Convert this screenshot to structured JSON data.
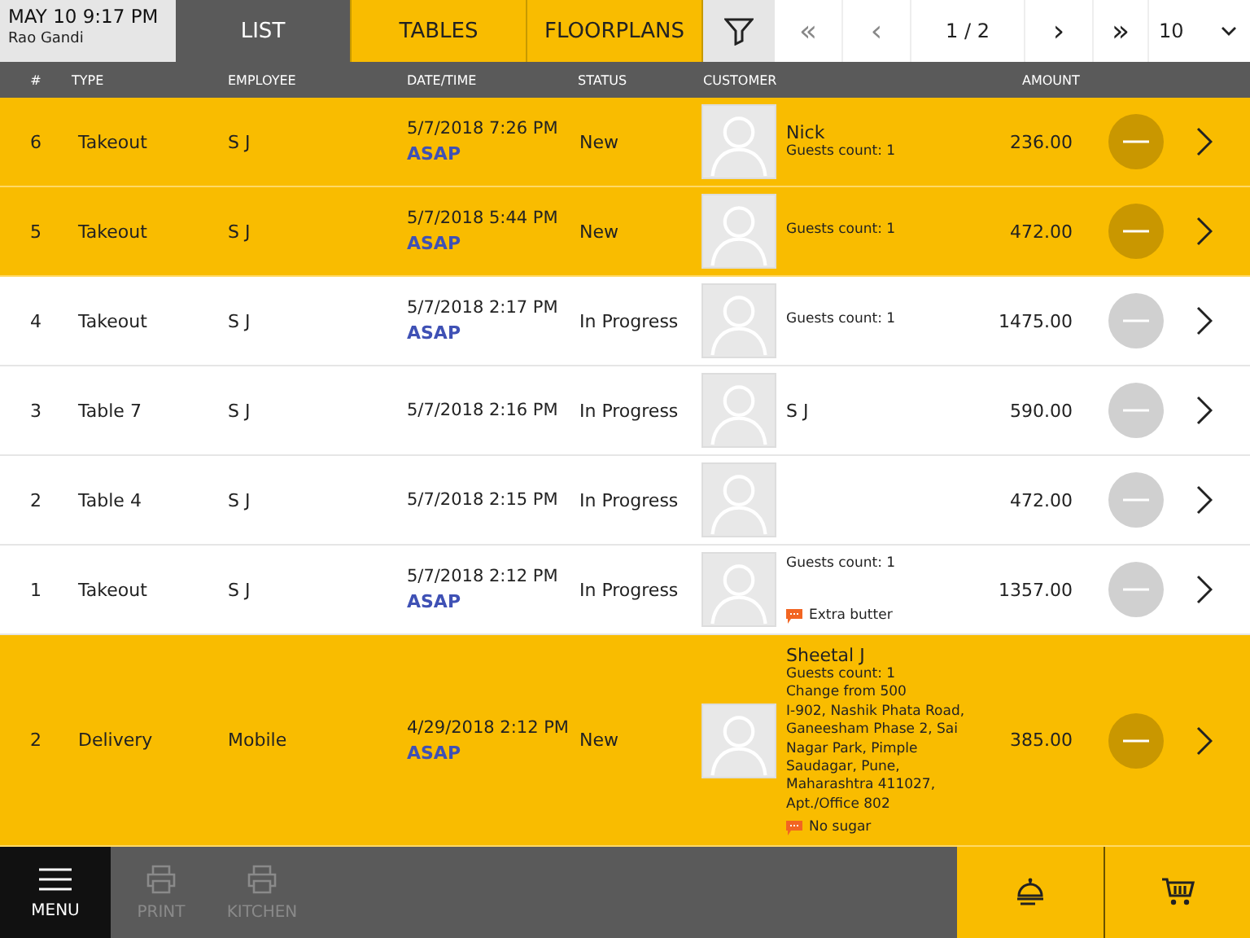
{
  "header": {
    "date": "MAY 10 9:17 PM",
    "user": "Rao Gandi"
  },
  "tabs": [
    {
      "label": "LIST",
      "selected": true
    },
    {
      "label": "TABLES",
      "selected": false
    },
    {
      "label": "FLOORPLANS",
      "selected": false
    }
  ],
  "pager": {
    "first": "«",
    "prev": "‹",
    "page": "1 / 2",
    "next": "›",
    "last": "»",
    "page_size": "10"
  },
  "columns": [
    "#",
    "TYPE",
    "EMPLOYEE",
    "DATE/TIME",
    "STATUS",
    "CUSTOMER",
    "AMOUNT"
  ],
  "rows": [
    {
      "number": "6",
      "type": "Takeout",
      "employee": "S J",
      "datetime": "5/7/2018 7:26 PM",
      "asap": "ASAP",
      "status": "New",
      "highlighted": true,
      "customer": {
        "name": "Nick",
        "details": [
          "Guests count: 1"
        ]
      },
      "amount": "236.00"
    },
    {
      "number": "5",
      "type": "Takeout",
      "employee": "S J",
      "datetime": "5/7/2018 5:44 PM",
      "asap": "ASAP",
      "status": "New",
      "highlighted": true,
      "customer": {
        "details": [
          "Guests count: 1"
        ]
      },
      "amount": "472.00"
    },
    {
      "number": "4",
      "type": "Takeout",
      "employee": "S J",
      "datetime": "5/7/2018 2:17 PM",
      "asap": "ASAP",
      "status": "In Progress",
      "highlighted": false,
      "customer": {
        "details": [
          "Guests count: 1"
        ]
      },
      "amount": "1475.00"
    },
    {
      "number": "3",
      "type": "Table 7",
      "employee": "S J",
      "datetime": "5/7/2018 2:16 PM",
      "status": "In Progress",
      "highlighted": false,
      "customer": {
        "name": "S J"
      },
      "amount": "590.00"
    },
    {
      "number": "2",
      "type": "Table 4",
      "employee": "S J",
      "datetime": "5/7/2018 2:15 PM",
      "status": "In Progress",
      "highlighted": false,
      "customer": {},
      "amount": "472.00"
    },
    {
      "number": "1",
      "type": "Takeout",
      "employee": "S J",
      "datetime": "5/7/2018 2:12 PM",
      "asap": "ASAP",
      "status": "In Progress",
      "highlighted": false,
      "customer": {
        "details": [
          "Guests count: 1"
        ],
        "note": "Extra butter"
      },
      "amount": "1357.00"
    },
    {
      "number": "2",
      "type": "Delivery",
      "employee": "Mobile",
      "datetime": "4/29/2018 2:12 PM",
      "asap": "ASAP",
      "status": "New",
      "highlighted": true,
      "customer": {
        "name": "Sheetal  J",
        "details": [
          "Guests count: 1",
          "Change from 500",
          "I-902, Nashik Phata Road, Ganeesham Phase 2, Sai Nagar Park, Pimple Saudagar, Pune, Maharashtra 411027, Apt./Office 802"
        ],
        "note": "No sugar"
      },
      "amount": "385.00"
    }
  ],
  "bottom_bar": [
    {
      "label": "MENU",
      "disabled": false
    },
    {
      "label": "PRINT",
      "disabled": true
    },
    {
      "label": "KITCHEN",
      "disabled": true
    }
  ]
}
